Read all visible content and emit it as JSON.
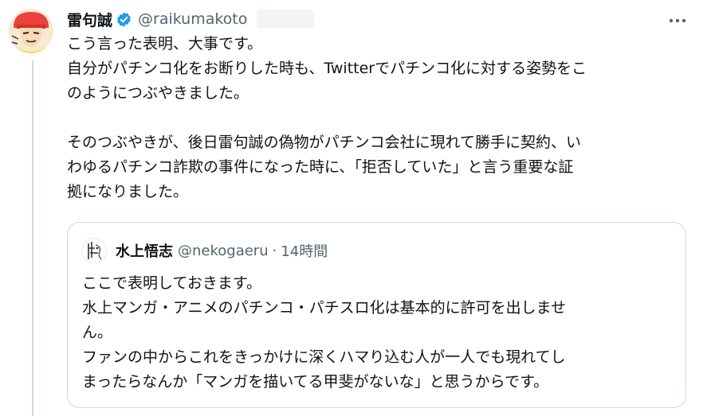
{
  "tweet": {
    "display_name": "雷句誠",
    "handle": "@raikumakoto",
    "verified_icon": "verified-badge-icon",
    "more_icon": "more-options-icon",
    "body_lines": [
      "こう言った表明、大事です。",
      "自分がパチンコ化をお断りした時も、Twitterでパチンコ化に対する姿勢をこ",
      "のようにつぶやきました。",
      "",
      "そのつぶやきが、後日雷句誠の偽物がパチンコ会社に現れて勝手に契約、い",
      "わゆるパチンコ詐欺の事件になった時に、「拒否していた」と言う重要な証",
      "拠になりました。"
    ]
  },
  "quote": {
    "display_name": "水上悟志",
    "handle": "@nekogaeru",
    "separator": "·",
    "time": "14時間",
    "body_lines": [
      "ここで表明しておきます。",
      "水上マンガ・アニメのパチンコ・パチスロ化は基本的に許可を出しませ",
      "ん。",
      "ファンの中からこれをきっかけに深くハマり込む人が一人でも現れてし",
      "まったらなんか「マンガを描いてる甲斐がないな」と思うからです。"
    ]
  },
  "colors": {
    "text_primary": "#0f1419",
    "text_secondary": "#536471",
    "verified_blue": "#1d9bf0",
    "border": "#cfd9de"
  }
}
